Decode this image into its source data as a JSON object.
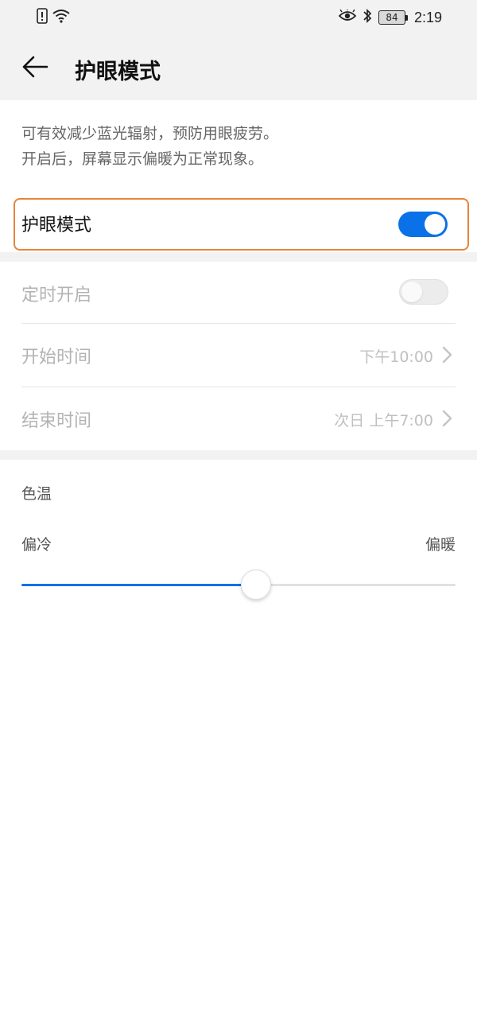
{
  "status_bar": {
    "icons_left": [
      "alert-sim-icon",
      "wifi-icon"
    ],
    "icons_right": [
      "eye-icon",
      "bluetooth-icon"
    ],
    "battery": "84",
    "time": "2:19"
  },
  "header": {
    "back_icon": "back-arrow-icon",
    "title": "护眼模式"
  },
  "description": {
    "line1": "可有效减少蓝光辐射，预防用眼疲劳。",
    "line2": "开启后，屏幕显示偏暖为正常现象。"
  },
  "eye_comfort": {
    "label": "护眼模式",
    "enabled": true,
    "accent_color": "#0a71e8",
    "highlight_color": "#e8833a"
  },
  "schedule": {
    "timer": {
      "label": "定时开启",
      "enabled": false
    },
    "start": {
      "label": "开始时间",
      "value": "下午10:00"
    },
    "end": {
      "label": "结束时间",
      "value": "次日 上午7:00"
    }
  },
  "color_temperature": {
    "title": "色温",
    "left_label": "偏冷",
    "right_label": "偏暖",
    "value_fraction": 0.54
  }
}
